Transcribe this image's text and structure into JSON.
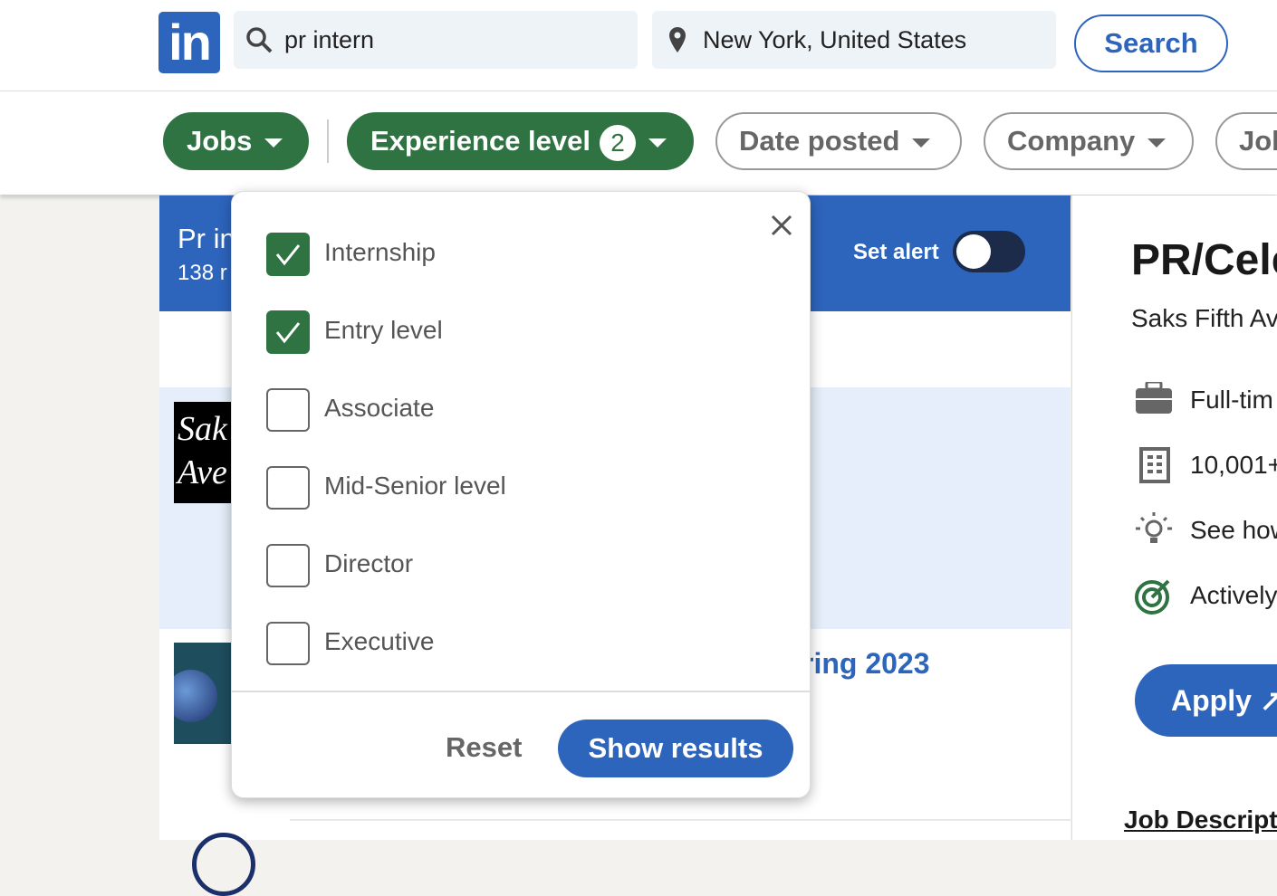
{
  "header": {
    "logo": "in",
    "search_query": "pr intern",
    "location": "New York, United States",
    "search_label": "Search"
  },
  "filters": {
    "pills": [
      {
        "label": "Jobs",
        "active": true
      },
      {
        "label": "Experience level",
        "active": true,
        "count": "2"
      },
      {
        "label": "Date posted",
        "active": false
      },
      {
        "label": "Company",
        "active": false
      },
      {
        "label": "Job",
        "active": false
      }
    ]
  },
  "results": {
    "title": "Pr in",
    "count": "138 r",
    "set_alert": "Set alert",
    "alert_on": false,
    "items": [
      {
        "logo": "Saks Fifth Avenue logo",
        "selected": true
      },
      {
        "title": "ring 2023",
        "selected": false
      }
    ]
  },
  "experience_dropdown": {
    "options": [
      {
        "label": "Internship",
        "checked": true
      },
      {
        "label": "Entry level",
        "checked": true
      },
      {
        "label": "Associate",
        "checked": false
      },
      {
        "label": "Mid-Senior level",
        "checked": false
      },
      {
        "label": "Director",
        "checked": false
      },
      {
        "label": "Executive",
        "checked": false
      }
    ],
    "reset": "Reset",
    "show_results": "Show results"
  },
  "job_detail": {
    "title": "PR/Cele",
    "company": "Saks Fifth Av",
    "insights": [
      {
        "icon": "briefcase-icon",
        "text": "Full-tim"
      },
      {
        "icon": "building-icon",
        "text": "10,001+"
      },
      {
        "icon": "lightbulb-icon",
        "text": "See how"
      },
      {
        "icon": "target-icon",
        "text": "Actively"
      }
    ],
    "apply": "Apply",
    "description_heading": "Job Descript"
  },
  "colors": {
    "brand_blue": "#2d64bc",
    "filter_green": "#2f7343",
    "selected_bg": "#e5eefa"
  }
}
